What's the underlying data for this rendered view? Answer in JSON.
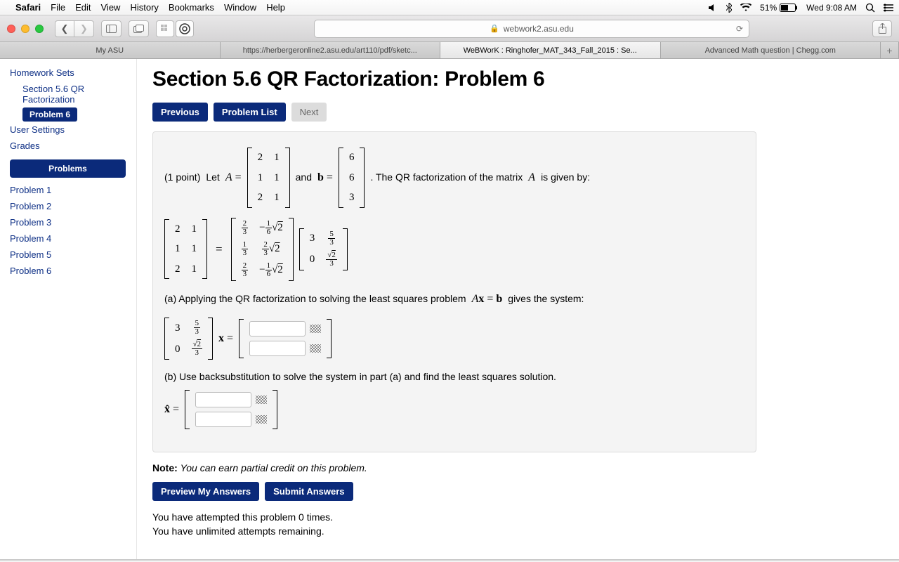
{
  "menubar": {
    "app": "Safari",
    "items": [
      "File",
      "Edit",
      "View",
      "History",
      "Bookmarks",
      "Window",
      "Help"
    ],
    "battery_pct": "51%",
    "clock": "Wed 9:08 AM"
  },
  "toolbar": {
    "address_host": "webwork2.asu.edu"
  },
  "tabs": [
    {
      "label": "My ASU",
      "active": false
    },
    {
      "label": "https://herbergeronline2.asu.edu/art110/pdf/sketc...",
      "active": false
    },
    {
      "label": "WeBWorK : Ringhofer_MAT_343_Fall_2015 : Se...",
      "active": true
    },
    {
      "label": "Advanced Math question | Chegg.com",
      "active": false
    }
  ],
  "sidebar": {
    "homework_sets": "Homework Sets",
    "section_link": "Section 5.6 QR Factorization",
    "current": "Problem 6",
    "user_settings": "User Settings",
    "grades": "Grades",
    "problems_header": "Problems",
    "problems": [
      "Problem 1",
      "Problem 2",
      "Problem 3",
      "Problem 4",
      "Problem 5",
      "Problem 6"
    ]
  },
  "content": {
    "title": "Section 5.6 QR Factorization: Problem 6",
    "nav": {
      "prev": "Previous",
      "list": "Problem List",
      "next": "Next"
    },
    "points_label": "(1 point)",
    "let_text": "Let",
    "and_text": "and",
    "tail_text": ". The QR factorization of the matrix",
    "given_by_text": "is given by:",
    "matrix_A": [
      [
        "2",
        "1"
      ],
      [
        "1",
        "1"
      ],
      [
        "2",
        "1"
      ]
    ],
    "vector_b": [
      [
        "6"
      ],
      [
        "6"
      ],
      [
        "3"
      ]
    ],
    "matrix_Q": [
      [
        {
          "frac": [
            "2",
            "3"
          ]
        },
        {
          "neg": true,
          "frac": [
            "1",
            "6"
          ],
          "sqrt": "2"
        }
      ],
      [
        {
          "frac": [
            "1",
            "3"
          ]
        },
        {
          "frac": [
            "2",
            "3"
          ],
          "sqrt": "2"
        }
      ],
      [
        {
          "frac": [
            "2",
            "3"
          ]
        },
        {
          "neg": true,
          "frac": [
            "1",
            "6"
          ],
          "sqrt": "2"
        }
      ]
    ],
    "matrix_R": [
      [
        "3",
        {
          "frac": [
            "5",
            "3"
          ]
        }
      ],
      [
        "0",
        {
          "sqrtfrac": [
            "2",
            "3"
          ]
        }
      ]
    ],
    "part_a": "(a) Applying the QR factorization to solving the least squares problem",
    "part_a_tail": "gives the system:",
    "ax_eq_b": "A𝐱 = 𝐛",
    "x_eq": "𝐱 =",
    "xhat_eq": "𝐱̂ =",
    "part_b": "(b) Use backsubstitution to solve the system in part (a) and find the least squares solution.",
    "note_label": "Note:",
    "note_text": "You can earn partial credit on this problem.",
    "preview_btn": "Preview My Answers",
    "submit_btn": "Submit Answers",
    "attempts_line1": "You have attempted this problem 0 times.",
    "attempts_line2": "You have unlimited attempts remaining."
  }
}
